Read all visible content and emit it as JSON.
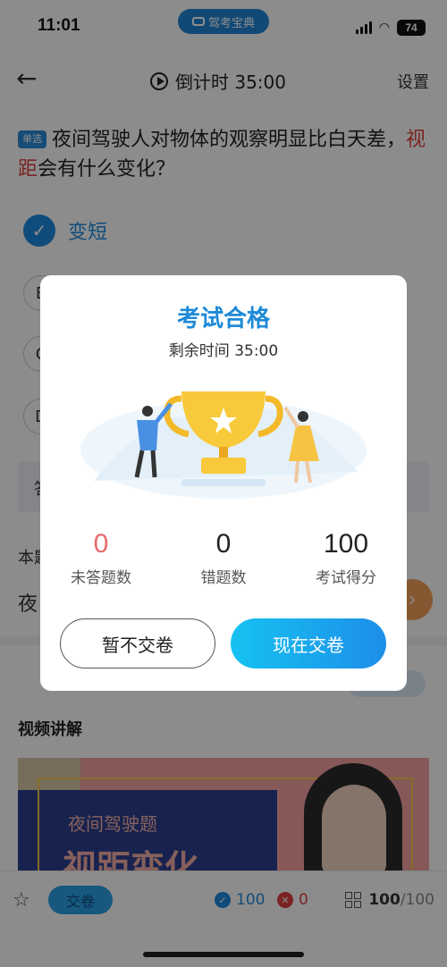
{
  "status_bar": {
    "time": "11:01",
    "battery": "74",
    "brand": "驾考宝典"
  },
  "nav": {
    "countdown_label": "倒计时 35:00",
    "settings": "设置"
  },
  "question": {
    "tag": "单选",
    "text_before": "夜间驾驶人对物体的观察明显比白天差，",
    "highlight": "视距",
    "text_after": "会有什么变化？"
  },
  "options": {
    "a_label": "变短",
    "b_letter": "B",
    "c_letter": "C",
    "d_letter": "D"
  },
  "background": {
    "answer_partial": "答",
    "this_q_partial": "本题",
    "night_partial": "夜",
    "video_heading": "视频讲解",
    "video_subtitle": "夜间驾驶题",
    "video_title": "视距变化"
  },
  "bottom_bar": {
    "submit": "交卷",
    "correct_count": "100",
    "wrong_count": "0",
    "progress_current": "100",
    "progress_total": "/100"
  },
  "modal": {
    "title": "考试合格",
    "remaining": "剩余时间 35:00",
    "stats": [
      {
        "value": "0",
        "label": "未答题数"
      },
      {
        "value": "0",
        "label": "错题数"
      },
      {
        "value": "100",
        "label": "考试得分"
      }
    ],
    "btn_later": "暂不交卷",
    "btn_now": "现在交卷"
  },
  "colors": {
    "accent": "#1d8ad8",
    "wrong": "#e04040",
    "gradient_start": "#16c2f2",
    "gradient_end": "#1d8ee8"
  }
}
